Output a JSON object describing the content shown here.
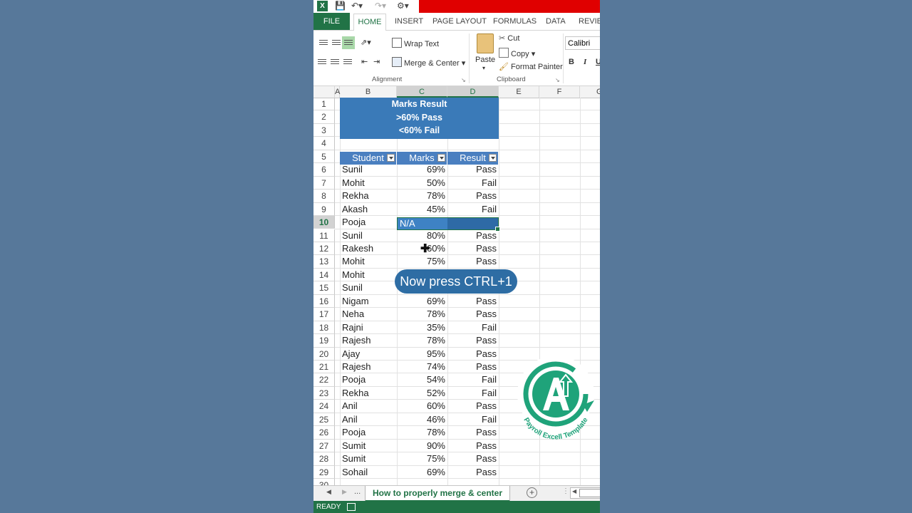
{
  "titlebar": {
    "app_icon": "excel-icon"
  },
  "tabs": [
    {
      "label": "FILE"
    },
    {
      "label": "HOME"
    },
    {
      "label": "INSERT"
    },
    {
      "label": "PAGE LAYOUT"
    },
    {
      "label": "FORMULAS"
    },
    {
      "label": "DATA"
    },
    {
      "label": "REVIEW"
    }
  ],
  "ribbon": {
    "wrap_text": "Wrap Text",
    "merge_center": "Merge & Center",
    "alignment_label": "Alignment",
    "paste": "Paste",
    "cut": "Cut",
    "copy": "Copy",
    "format_painter": "Format Painter",
    "clipboard_label": "Clipboard",
    "font_name": "Calibri",
    "bold": "B",
    "italic": "I",
    "underline": "U"
  },
  "columns": [
    "A",
    "B",
    "C",
    "D",
    "E",
    "F",
    "G"
  ],
  "info_box": [
    "Marks  Result",
    ">60%  Pass",
    "<60%  Fail"
  ],
  "table_headers": {
    "student": "Student",
    "marks": "Marks",
    "result": "Result"
  },
  "rows": [
    {
      "n": "6",
      "student": "Sunil",
      "marks": "69%",
      "result": "Pass"
    },
    {
      "n": "7",
      "student": "Mohit",
      "marks": "50%",
      "result": "Fail"
    },
    {
      "n": "8",
      "student": "Rekha",
      "marks": "78%",
      "result": "Pass"
    },
    {
      "n": "9",
      "student": "Akash",
      "marks": "45%",
      "result": "Fail"
    },
    {
      "n": "10",
      "student": "Pooja",
      "marks": "",
      "result": ""
    },
    {
      "n": "11",
      "student": "Sunil",
      "marks": "80%",
      "result": "Pass"
    },
    {
      "n": "12",
      "student": "Rakesh",
      "marks": "60%",
      "result": "Pass"
    },
    {
      "n": "13",
      "student": "Mohit",
      "marks": "75%",
      "result": "Pass"
    },
    {
      "n": "14",
      "student": "Mohit",
      "marks": "",
      "result": ""
    },
    {
      "n": "15",
      "student": "Sunil",
      "marks": "",
      "result": ""
    },
    {
      "n": "16",
      "student": "Nigam",
      "marks": "69%",
      "result": "Pass"
    },
    {
      "n": "17",
      "student": "Neha",
      "marks": "78%",
      "result": "Pass"
    },
    {
      "n": "18",
      "student": "Rajni",
      "marks": "35%",
      "result": "Fail"
    },
    {
      "n": "19",
      "student": "Rajesh",
      "marks": "78%",
      "result": "Pass"
    },
    {
      "n": "20",
      "student": "Ajay",
      "marks": "95%",
      "result": "Pass"
    },
    {
      "n": "21",
      "student": "Rajesh",
      "marks": "74%",
      "result": "Pass"
    },
    {
      "n": "22",
      "student": "Pooja",
      "marks": "54%",
      "result": "Fail"
    },
    {
      "n": "23",
      "student": "Rekha",
      "marks": "52%",
      "result": "Fail"
    },
    {
      "n": "24",
      "student": "Anil",
      "marks": "60%",
      "result": "Pass"
    },
    {
      "n": "25",
      "student": "Anil",
      "marks": "46%",
      "result": "Fail"
    },
    {
      "n": "26",
      "student": "Pooja",
      "marks": "78%",
      "result": "Pass"
    },
    {
      "n": "27",
      "student": "Sumit",
      "marks": "90%",
      "result": "Pass"
    },
    {
      "n": "28",
      "student": "Sumit",
      "marks": "75%",
      "result": "Pass"
    },
    {
      "n": "29",
      "student": "Sohail",
      "marks": "69%",
      "result": "Pass"
    }
  ],
  "selected_cell_value": "N/A",
  "overlay": "Now press CTRL+1",
  "sheet_tab": "How to properly merge & center",
  "sheet_nav_more": "...",
  "status": "READY",
  "logo": {
    "text": "Payroll Excell Template",
    "color": "#1fa37a"
  },
  "colors": {
    "excel_green": "#217346",
    "table_header": "#4a7fc0",
    "info_fill": "#3a7ab8",
    "title_red": "#e00000"
  }
}
